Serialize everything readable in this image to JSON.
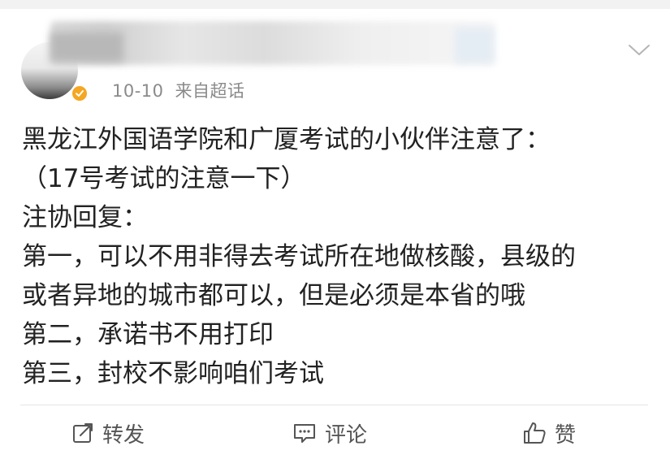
{
  "post": {
    "date": "10-10",
    "source": "来自超话",
    "lines": [
      "黑龙江外国语学院和广厦考试的小伙伴注意了：",
      "（17号考试的注意一下）",
      "注协回复：",
      "第一，可以不用非得去考试所在地做核酸，县级的",
      "或者异地的城市都可以，但是必须是本省的哦",
      "第二，承诺书不用打印",
      "第三，封校不影响咱们考试"
    ]
  },
  "actions": {
    "repost_label": "转发",
    "comment_label": "评论",
    "like_label": "赞"
  },
  "colors": {
    "verified_badge": "#f5a623",
    "meta_text": "#8a8a8a",
    "action_text": "#555555"
  }
}
